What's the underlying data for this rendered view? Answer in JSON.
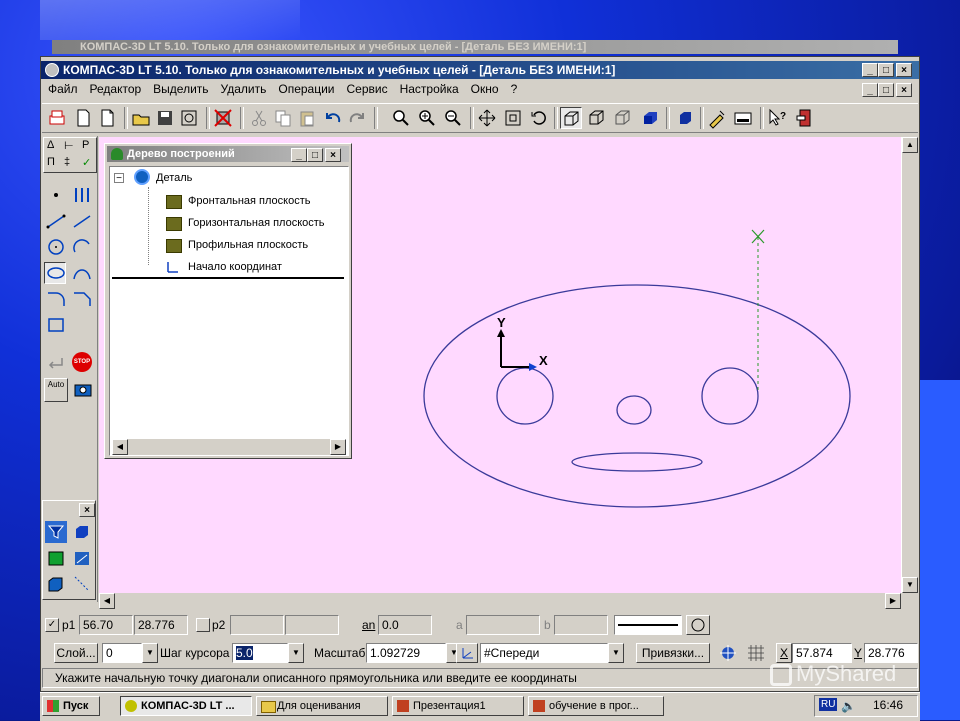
{
  "ghost_title": "КОМПАС-3D LT 5.10. Только для ознакомительных и учебных целей - [Деталь БЕЗ ИМЕНИ:1]",
  "app": {
    "title": "КОМПАС-3D LT 5.10. Только для ознакомительных и учебных целей - [Деталь БЕЗ ИМЕНИ:1]",
    "min": "_",
    "max": "□",
    "close": "×"
  },
  "menu": [
    "Файл",
    "Редактор",
    "Выделить",
    "Удалить",
    "Операции",
    "Сервис",
    "Настройка",
    "Окно",
    "?"
  ],
  "compact_toolbar": {
    "row1": [
      "Δ",
      "⊢",
      "P"
    ],
    "row2": [
      "П",
      "‡",
      "✓"
    ]
  },
  "tree_panel": {
    "title": "Дерево построений",
    "root": "Деталь",
    "items": [
      "Фронтальная плоскость",
      "Горизонтальная плоскость",
      "Профильная плоскость",
      "Начало координат"
    ],
    "expander": "−"
  },
  "drawing": {
    "axis_y": "Y",
    "axis_x": "X",
    "cursor_mark": "×"
  },
  "side_buttons": {
    "stop": "STOP",
    "auto": "Auto"
  },
  "small_panel_close": "×",
  "status_row1": {
    "p1_label": "p1",
    "p1_x": "56.70",
    "p1_y": "28.776",
    "p2_label": "p2",
    "an_label": "an",
    "an_value": "0.0",
    "a_label": "a",
    "b_label": "b"
  },
  "status_row2": {
    "layer_button": "Слой...",
    "layer_value": "0",
    "step_label": "Шаг курсора",
    "step_value": "5.0",
    "scale_label": "Масштаб",
    "scale_value": "1.092729",
    "view_value": "#Спереди",
    "snaps_button": "Привязки...",
    "x_label": "X",
    "x_value": "57.874",
    "y_label": "Y",
    "y_value": "28.776"
  },
  "hint": "Укажите начальную точку диагонали описанного прямоугольника или введите ее координаты",
  "taskbar": {
    "start": "Пуск",
    "tasks": [
      "КОМПАС-3D LT ...",
      "Для оценивания",
      "Презентация1",
      "обучение в прог..."
    ],
    "lang": "RU",
    "time": "16:46"
  },
  "watermark": "MyShared",
  "colors": {
    "canvas": "#ffd9ff",
    "shape_stroke": "#3a3a9a",
    "title_active": "#0a246a",
    "window_face": "#d4d0c8",
    "slide_blue": "#1030d8"
  }
}
